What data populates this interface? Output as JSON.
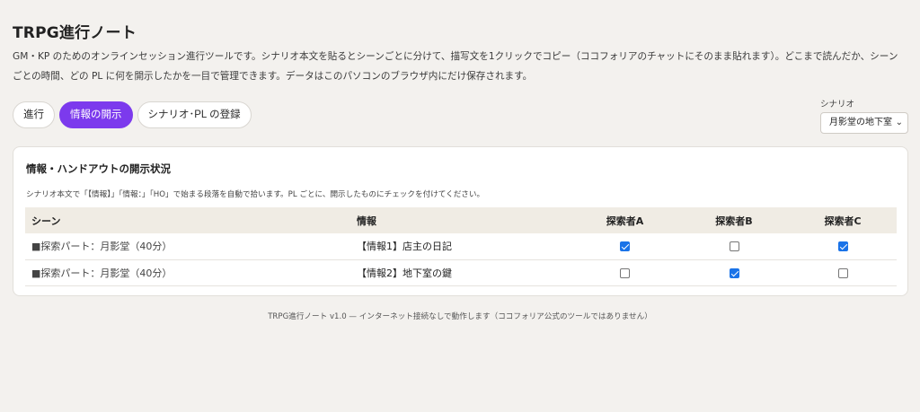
{
  "app": {
    "title": "TRPG進行ノート",
    "description": "GM・KP のためのオンラインセッション進行ツールです。シナリオ本文を貼るとシーンごとに分けて、描写文を1クリックでコピー（ココフォリアのチャットにそのまま貼れます）。どこまで読んだか、シーンごとの時間、どの PL に何を開示したかを一目で管理できます。データはこのパソコンのブラウザ内にだけ保存されます。"
  },
  "tabs": [
    {
      "label": "進行",
      "active": false
    },
    {
      "label": "情報の開示",
      "active": true
    },
    {
      "label": "シナリオ･PL の登録",
      "active": false
    }
  ],
  "scenario": {
    "label": "シナリオ",
    "selected": "月影堂の地下室"
  },
  "card": {
    "title": "情報・ハンドアウトの開示状況",
    "note": "シナリオ本文で「【情報】」「情報：」「HO」で始まる段落を自動で拾います。PL ごとに、開示したものにチェックを付けてください。",
    "columns": [
      "シーン",
      "情報",
      "探索者A",
      "探索者B",
      "探索者C"
    ],
    "rows": [
      {
        "scene": "■探索パート：月影堂（40分）",
        "info": "【情報1】店主の日記",
        "checks": [
          true,
          false,
          true
        ]
      },
      {
        "scene": "■探索パート：月影堂（40分）",
        "info": "【情報2】地下室の鍵",
        "checks": [
          false,
          true,
          false
        ]
      }
    ]
  },
  "footer": "TRPG進行ノート v1.0 — インターネット接続なしで動作します（ココフォリア公式のツールではありません）",
  "colors": {
    "accent": "#7c3aed",
    "checkbox": "#1a73e8",
    "background": "#f3f1ee"
  }
}
